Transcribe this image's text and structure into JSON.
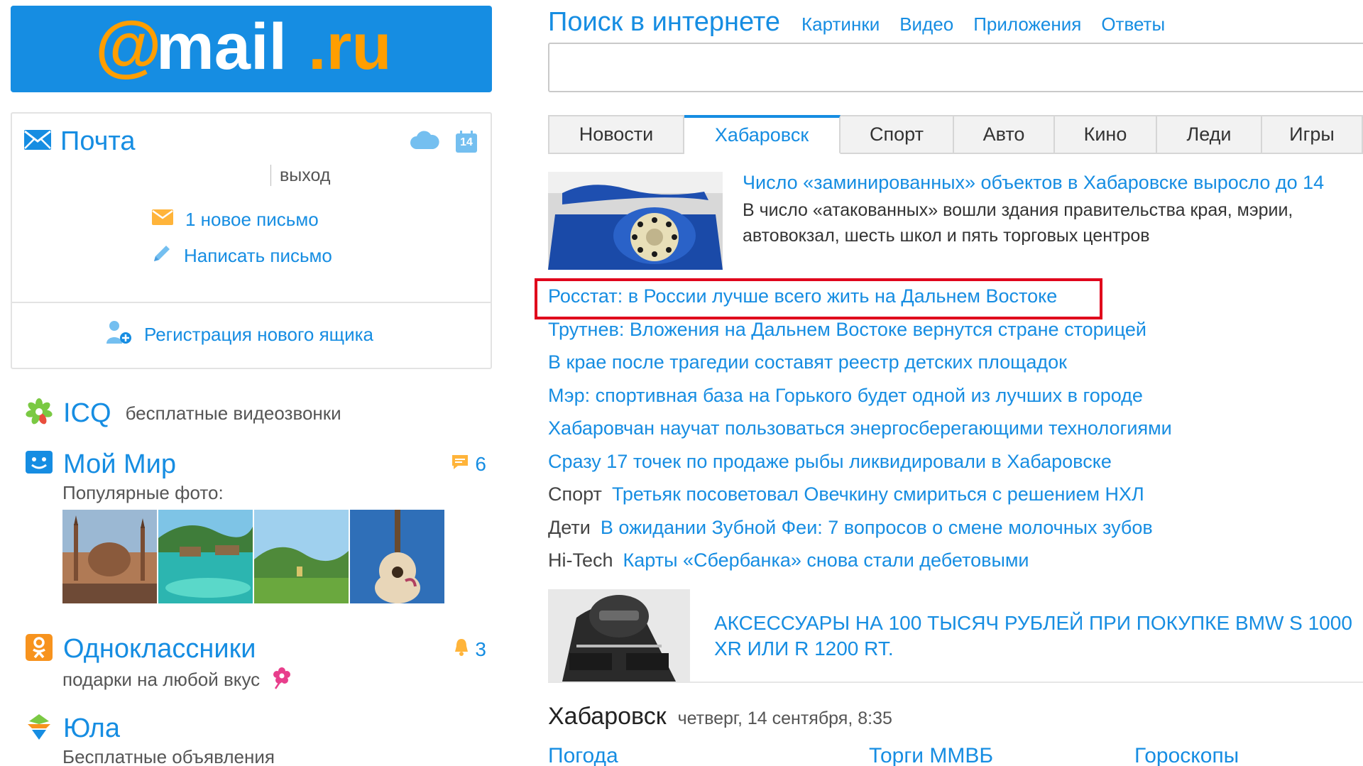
{
  "logo": {
    "text": "@mail.ru"
  },
  "mail": {
    "title": "Почта",
    "calendar_day": "14",
    "logout": "выход",
    "new_letters": "1 новое письмо",
    "compose": "Написать письмо",
    "register": "Регистрация нового ящика"
  },
  "services": {
    "icq": {
      "name": "ICQ",
      "desc": "бесплатные видеозвонки"
    },
    "mir": {
      "name": "Мой Мир",
      "count": "6",
      "sub": "Популярные фото:"
    },
    "ok": {
      "name": "Одноклассники",
      "count": "3",
      "sub": "подарки на любой вкус"
    },
    "yula": {
      "name": "Юла",
      "sub": "Бесплатные объявления"
    }
  },
  "search": {
    "title": "Поиск в интернете",
    "links": [
      "Картинки",
      "Видео",
      "Приложения",
      "Ответы"
    ],
    "value": ""
  },
  "tabs": [
    "Новости",
    "Хабаровск",
    "Спорт",
    "Авто",
    "Кино",
    "Леди",
    "Игры"
  ],
  "top_news": {
    "headline": "Число «заминированных» объектов в Хабаровске выросло до 14",
    "lead": "В число «атакованных» вошли здания правительства края, мэрии, автовокзал, шесть школ и пять торговых центров"
  },
  "news": [
    {
      "cat": "",
      "title": "Росстат: в России лучше всего жить на Дальнем Востоке"
    },
    {
      "cat": "",
      "title": "Трутнев: Вложения на Дальнем Востоке вернутся стране сторицей"
    },
    {
      "cat": "",
      "title": "В крае после трагедии составят реестр детских площадок"
    },
    {
      "cat": "",
      "title": "Мэр: спортивная база на Горького будет одной из лучших в городе"
    },
    {
      "cat": "",
      "title": "Хабаровчан научат пользоваться энергосберегающими технологиями"
    },
    {
      "cat": "",
      "title": "Сразу 17 точек по продаже рыбы ликвидировали в Хабаровске"
    },
    {
      "cat": "Спорт",
      "title": "Третьяк посоветовал Овечкину смириться с решением НХЛ"
    },
    {
      "cat": "Дети",
      "title": "В ожидании Зубной Феи: 7 вопросов о смене молочных зубов"
    },
    {
      "cat": "Hi-Tech",
      "title": "Карты «Сбербанка» снова стали дебетовыми"
    }
  ],
  "ad": {
    "text": "АКСЕССУАРЫ НА 100 ТЫСЯЧ РУБЛЕЙ ПРИ ПОКУПКЕ BMW S 1000 XR или R 1200 RT."
  },
  "city": {
    "name": "Хабаровск",
    "date": "четверг, 14 сентября, 8:35"
  },
  "bottom_links": [
    "Погода",
    "Торги ММВБ",
    "Гороскопы"
  ],
  "colors": {
    "brand_blue": "#168de2",
    "logo_orange": "#ff9e00",
    "highlight_red": "#e0001b"
  }
}
